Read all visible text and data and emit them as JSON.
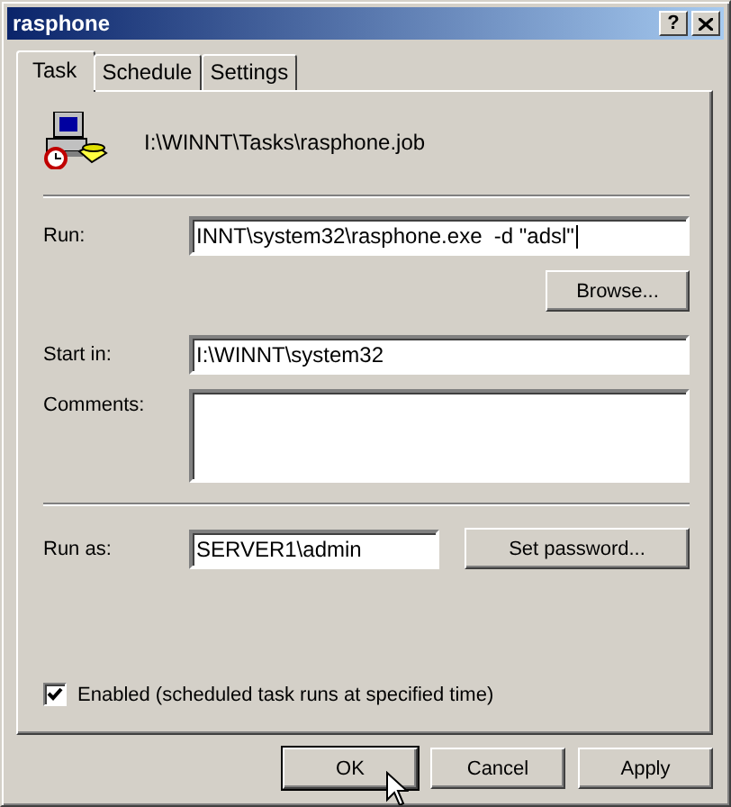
{
  "window": {
    "title": "rasphone",
    "help_button": "?"
  },
  "tabs": [
    {
      "label": "Task",
      "selected": true
    },
    {
      "label": "Schedule",
      "selected": false
    },
    {
      "label": "Settings",
      "selected": false
    }
  ],
  "task_file": "I:\\WINNT\\Tasks\\rasphone.job",
  "run": {
    "label": "Run:",
    "value": "INNT\\system32\\rasphone.exe  -d \"adsl\"",
    "browse_button": "Browse..."
  },
  "start_in": {
    "label": "Start in:",
    "value": "I:\\WINNT\\system32"
  },
  "comments": {
    "label": "Comments:"
  },
  "run_as": {
    "label": "Run as:",
    "value": "SERVER1\\admin",
    "set_password_button": "Set password..."
  },
  "enabled": {
    "label": "Enabled (scheduled task runs at specified time)",
    "checked": true
  },
  "buttons": [
    {
      "label": "OK",
      "default": true
    },
    {
      "label": "Cancel",
      "default": false
    },
    {
      "label": "Apply",
      "default": false
    }
  ]
}
